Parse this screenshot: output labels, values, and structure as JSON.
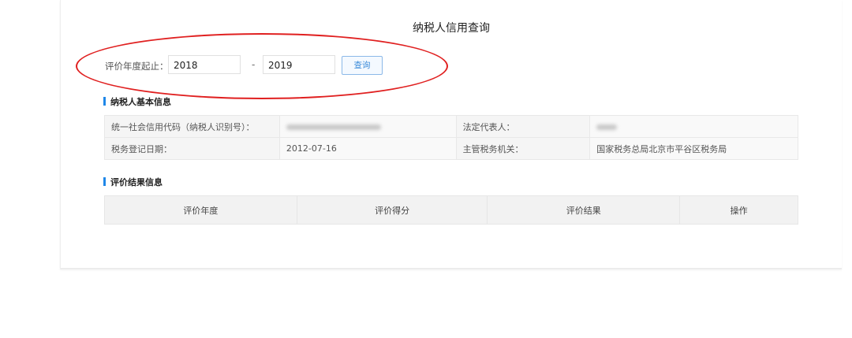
{
  "page": {
    "title": "纳税人信用查询"
  },
  "filter": {
    "label": "评价年度起止：",
    "start_year": "2018",
    "separator": "-",
    "end_year": "2019",
    "query_label": "查询"
  },
  "basic_info": {
    "section_title": "纳税人基本信息",
    "rows": [
      {
        "label1": "统一社会信用代码（纳税人识别号）：",
        "value1": "",
        "label2": "法定代表人：",
        "value2": ""
      },
      {
        "label1": "税务登记日期：",
        "value1": "2012-07-16",
        "label2": "主管税务机关：",
        "value2": "国家税务总局北京市平谷区税务局"
      }
    ]
  },
  "results": {
    "section_title": "评价结果信息",
    "columns": [
      "评价年度",
      "评价得分",
      "评价结果",
      "操作"
    ]
  },
  "colors": {
    "accent": "#1f87e8",
    "annotation": "#e02020",
    "button_text": "#3b8bd9"
  }
}
